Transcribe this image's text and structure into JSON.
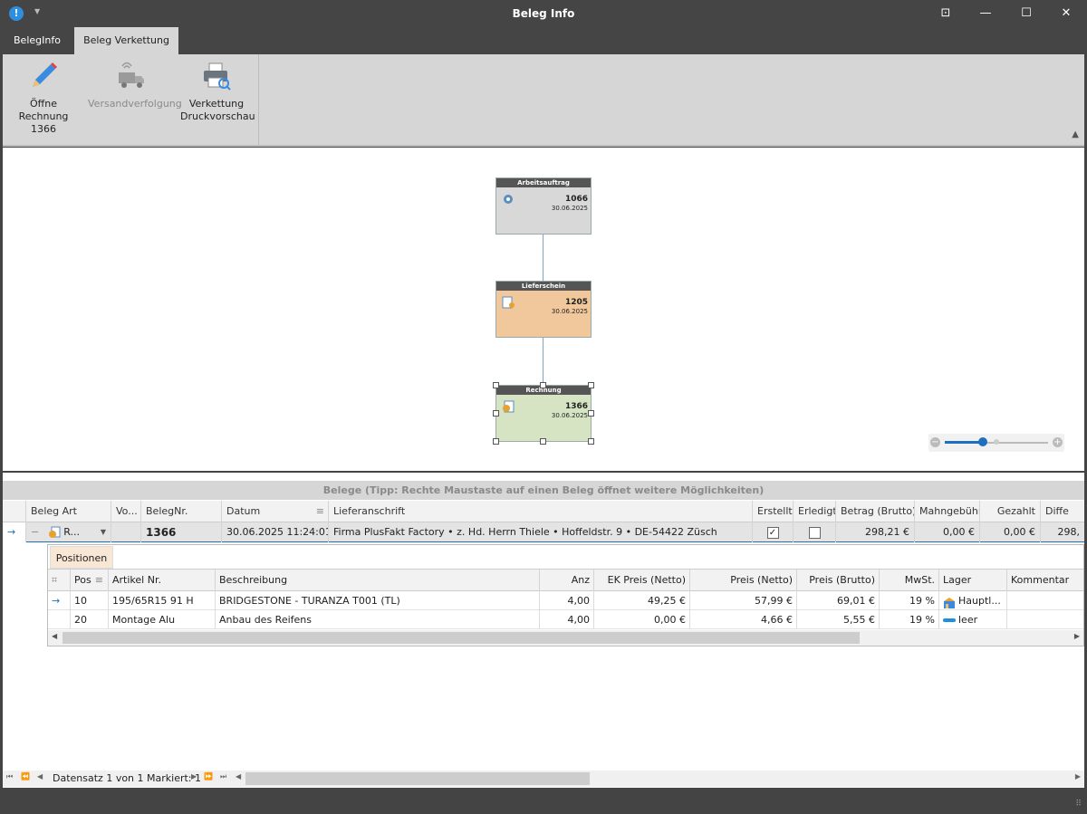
{
  "window": {
    "title": "Beleg Info",
    "app_icon_glyph": "!"
  },
  "tabs": [
    {
      "label": "BelegInfo"
    },
    {
      "label": "Beleg Verkettung"
    }
  ],
  "ribbon": {
    "buttons": [
      {
        "line1": "Öffne",
        "line2": "Rechnung 1366",
        "icon": "pencil-icon"
      },
      {
        "line1": "Versandverfolgung",
        "line2": "",
        "icon": "truck-icon"
      },
      {
        "line1": "Verkettung",
        "line2": "Druckvorschau",
        "icon": "printer-icon"
      }
    ]
  },
  "diagram": {
    "nodes": [
      {
        "header": "Arbeitsauftrag",
        "number": "1066",
        "date": "30.06.2025",
        "color": "#d8d8d8"
      },
      {
        "header": "Lieferschein",
        "number": "1205",
        "date": "30.06.2025",
        "color": "#f0c89b"
      },
      {
        "header": "Rechnung",
        "number": "1366",
        "date": "30.06.2025",
        "color": "#d6e4c4"
      }
    ],
    "zoom_level": 0.35
  },
  "grid": {
    "group_header": "Belege (Tipp: Rechte Maustaste auf einen Beleg öffnet weitere Möglichkeiten)",
    "columns": [
      "Beleg Art",
      "Vo...",
      "BelegNr.",
      "Datum",
      "Lieferanschrift",
      "Erstellt",
      "Erledigt",
      "Betrag (Brutto)",
      "Mahngebühr",
      "Gezahlt",
      "Diffe"
    ],
    "row": {
      "beleg_art": "R...",
      "vo": "",
      "belegnr": "1366",
      "datum": "30.06.2025 11:24:01",
      "lieferanschrift": "Firma PlusFakt Factory • z. Hd. Herrn Thiele • Hoffeldstr. 9 • DE-54422 Züsch",
      "erstellt": true,
      "erledigt": false,
      "betrag": "298,21 €",
      "mahngebuehr": "0,00 €",
      "gezahlt": "0,00 €",
      "diff": "298,"
    }
  },
  "detail": {
    "tab": "Positionen",
    "columns": [
      "Pos",
      "Artikel Nr.",
      "Beschreibung",
      "Anz",
      "EK Preis (Netto)",
      "Preis (Netto)",
      "Preis (Brutto)",
      "MwSt.",
      "Lager",
      "Kommentar"
    ],
    "rows": [
      {
        "pos": "10",
        "artikel": "195/65R15 91 H",
        "beschreibung": "BRIDGESTONE - TURANZA T001 (TL)",
        "anz": "4,00",
        "ek": "49,25 €",
        "netto": "57,99 €",
        "brutto": "69,01 €",
        "mwst": "19 %",
        "lager": "Hauptl...",
        "kommentar": ""
      },
      {
        "pos": "20",
        "artikel": "Montage Alu",
        "beschreibung": "Anbau des Reifens",
        "anz": "4,00",
        "ek": "0,00 €",
        "netto": "4,66 €",
        "brutto": "5,55 €",
        "mwst": "19 %",
        "lager": "leer",
        "kommentar": ""
      }
    ]
  },
  "navigator": {
    "status": "Datensatz 1 von 1 Markiert: 1"
  }
}
